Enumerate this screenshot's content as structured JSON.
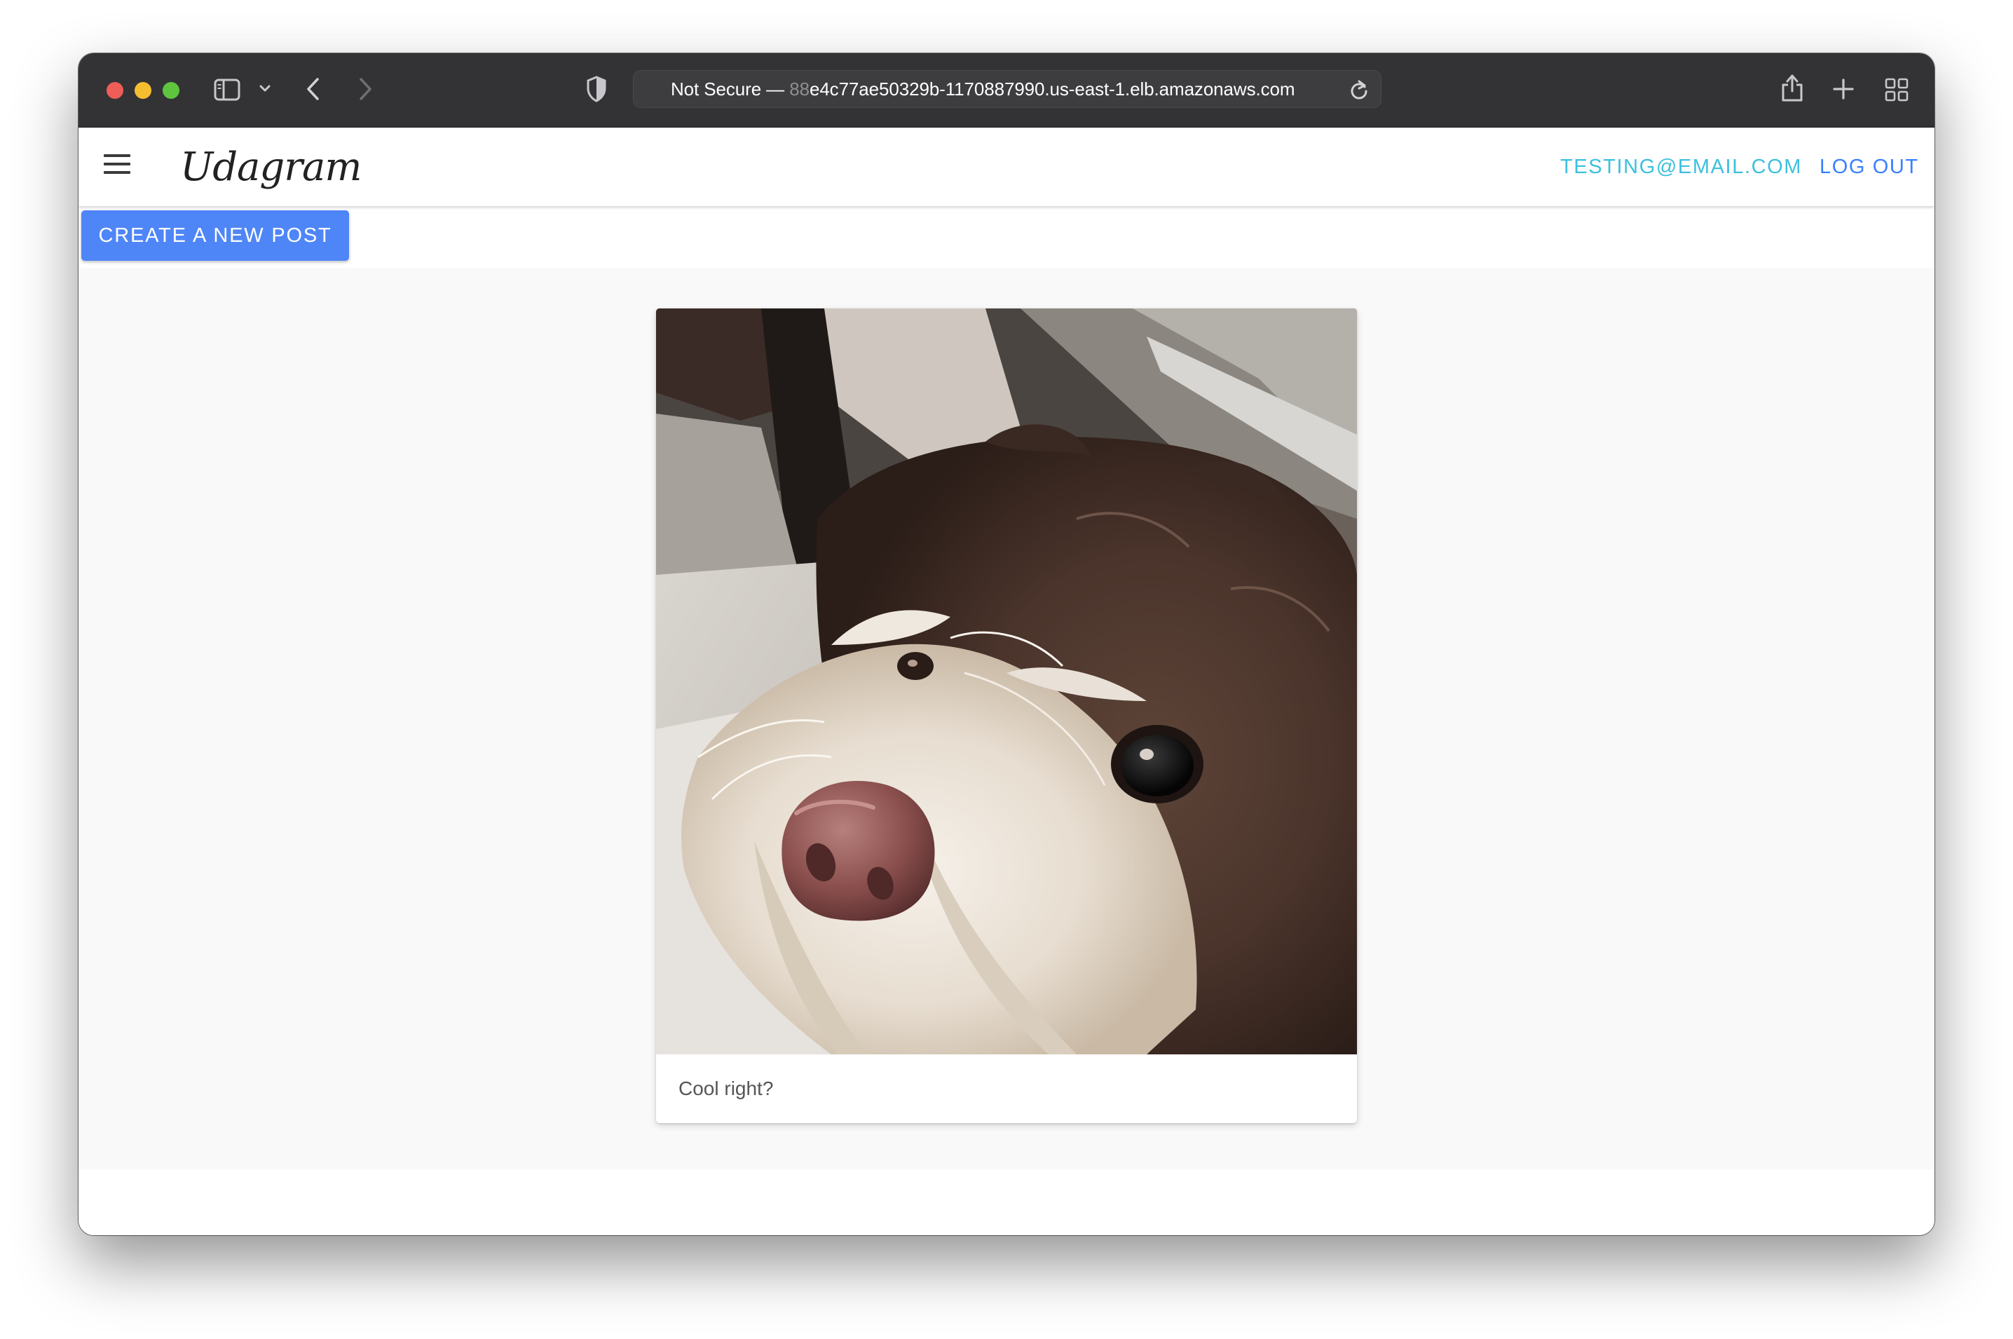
{
  "browser": {
    "url_prefix": "Not Secure —",
    "url_faded": "88",
    "url_main": "e4c77ae50329b-1170887990.us-east-1.elb.amazonaws.com",
    "icons": [
      "sidebar-icon",
      "chevron-down-icon",
      "back-icon",
      "forward-icon",
      "shield-icon",
      "reload-icon",
      "share-icon",
      "new-tab-icon",
      "tab-overview-icon"
    ]
  },
  "app": {
    "brand": "Udagram",
    "user_email": "testing@email.com",
    "logout_label": "Log Out",
    "create_label": "Create a New Post",
    "colors": {
      "primary": "#4f86f7",
      "secondary": "#3cc0dd",
      "tertiary": "#3880ff"
    }
  },
  "feed": {
    "posts": [
      {
        "caption": "Cool right?",
        "image": "dog-photo"
      }
    ]
  }
}
